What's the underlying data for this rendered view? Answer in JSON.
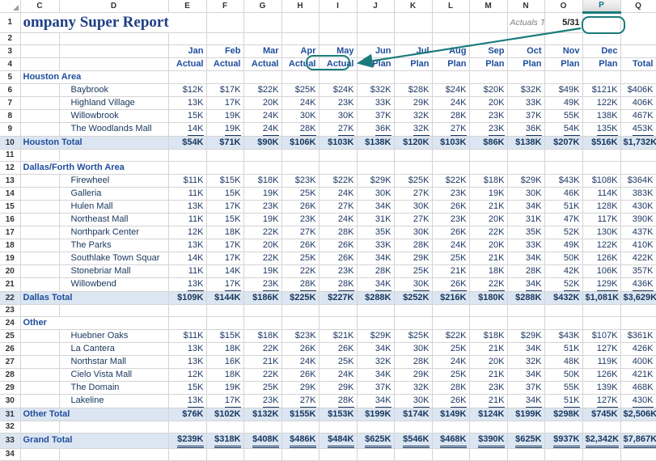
{
  "app": {
    "type": "spreadsheet",
    "accent_color": "#1a7b7b",
    "header_text_color": "#1f4e9c",
    "total_row_fill": "#dce6f2"
  },
  "column_headers": [
    "C",
    "D",
    "E",
    "F",
    "G",
    "H",
    "I",
    "J",
    "K",
    "L",
    "M",
    "N",
    "O",
    "P",
    "Q"
  ],
  "selected_column": "P",
  "row_headers": [
    "1",
    "2",
    "3",
    "4",
    "5",
    "6",
    "7",
    "8",
    "9",
    "10",
    "11",
    "12",
    "13",
    "14",
    "15",
    "16",
    "17",
    "18",
    "19",
    "20",
    "21",
    "22",
    "23",
    "24",
    "25",
    "26",
    "27",
    "28",
    "29",
    "30",
    "31",
    "32",
    "33",
    "34"
  ],
  "title": "ompany Super Report",
  "annotation": {
    "actuals_through_label": "Actuals Through:",
    "actuals_through_value": "5/31",
    "arrow_from": "P1 date box",
    "arrow_to": "May Actual header"
  },
  "headers": {
    "months": [
      "Jan",
      "Feb",
      "Mar",
      "Apr",
      "May",
      "Jun",
      "Jul",
      "Aug",
      "Sep",
      "Oct",
      "Nov",
      "Dec",
      ""
    ],
    "types": [
      "Actual",
      "Actual",
      "Actual",
      "Actual",
      "Actual",
      "Plan",
      "Plan",
      "Plan",
      "Plan",
      "Plan",
      "Plan",
      "Plan",
      "Total"
    ]
  },
  "sections": [
    {
      "row": 5,
      "name": "Houston Area",
      "rows": [
        {
          "row": 6,
          "label": "Baybrook",
          "values": [
            "$12K",
            "$17K",
            "$22K",
            "$25K",
            "$24K",
            "$32K",
            "$28K",
            "$24K",
            "$20K",
            "$32K",
            "$49K",
            "$121K",
            "$406K"
          ]
        },
        {
          "row": 7,
          "label": "Highland Village",
          "values": [
            "13K",
            "17K",
            "20K",
            "24K",
            "23K",
            "33K",
            "29K",
            "24K",
            "20K",
            "33K",
            "49K",
            "122K",
            "406K"
          ]
        },
        {
          "row": 8,
          "label": "Willowbrook",
          "values": [
            "15K",
            "19K",
            "24K",
            "30K",
            "30K",
            "37K",
            "32K",
            "28K",
            "23K",
            "37K",
            "55K",
            "138K",
            "467K"
          ]
        },
        {
          "row": 9,
          "label": "The Woodlands Mall",
          "underline": true,
          "values": [
            "14K",
            "19K",
            "24K",
            "28K",
            "27K",
            "36K",
            "32K",
            "27K",
            "23K",
            "36K",
            "54K",
            "135K",
            "453K"
          ]
        }
      ],
      "total": {
        "row": 10,
        "label": "Houston Total",
        "values": [
          "$54K",
          "$71K",
          "$90K",
          "$106K",
          "$103K",
          "$138K",
          "$120K",
          "$103K",
          "$86K",
          "$138K",
          "$207K",
          "$516K",
          "$1,732K"
        ]
      }
    },
    {
      "row": 12,
      "name": "Dallas/Forth Worth Area",
      "rows": [
        {
          "row": 13,
          "label": "Firewheel",
          "values": [
            "$11K",
            "$15K",
            "$18K",
            "$23K",
            "$22K",
            "$29K",
            "$25K",
            "$22K",
            "$18K",
            "$29K",
            "$43K",
            "$108K",
            "$364K"
          ]
        },
        {
          "row": 14,
          "label": "Galleria",
          "values": [
            "11K",
            "15K",
            "19K",
            "25K",
            "24K",
            "30K",
            "27K",
            "23K",
            "19K",
            "30K",
            "46K",
            "114K",
            "383K"
          ]
        },
        {
          "row": 15,
          "label": "Hulen Mall",
          "values": [
            "13K",
            "17K",
            "23K",
            "26K",
            "27K",
            "34K",
            "30K",
            "26K",
            "21K",
            "34K",
            "51K",
            "128K",
            "430K"
          ]
        },
        {
          "row": 16,
          "label": "Northeast Mall",
          "values": [
            "11K",
            "15K",
            "19K",
            "23K",
            "24K",
            "31K",
            "27K",
            "23K",
            "20K",
            "31K",
            "47K",
            "117K",
            "390K"
          ]
        },
        {
          "row": 17,
          "label": "Northpark Center",
          "values": [
            "12K",
            "18K",
            "22K",
            "27K",
            "28K",
            "35K",
            "30K",
            "26K",
            "22K",
            "35K",
            "52K",
            "130K",
            "437K"
          ]
        },
        {
          "row": 18,
          "label": "The Parks",
          "values": [
            "13K",
            "17K",
            "20K",
            "26K",
            "26K",
            "33K",
            "28K",
            "24K",
            "20K",
            "33K",
            "49K",
            "122K",
            "410K"
          ]
        },
        {
          "row": 19,
          "label": "Southlake Town Squar",
          "values": [
            "14K",
            "17K",
            "22K",
            "25K",
            "26K",
            "34K",
            "29K",
            "25K",
            "21K",
            "34K",
            "50K",
            "126K",
            "422K"
          ]
        },
        {
          "row": 20,
          "label": "Stonebriar Mall",
          "values": [
            "11K",
            "14K",
            "19K",
            "22K",
            "23K",
            "28K",
            "25K",
            "21K",
            "18K",
            "28K",
            "42K",
            "106K",
            "357K"
          ]
        },
        {
          "row": 21,
          "label": "Willowbend",
          "underline": true,
          "values": [
            "13K",
            "17K",
            "23K",
            "28K",
            "28K",
            "34K",
            "30K",
            "26K",
            "22K",
            "34K",
            "52K",
            "129K",
            "436K"
          ]
        }
      ],
      "total": {
        "row": 22,
        "label": "Dallas Total",
        "values": [
          "$109K",
          "$144K",
          "$186K",
          "$225K",
          "$227K",
          "$288K",
          "$252K",
          "$216K",
          "$180K",
          "$288K",
          "$432K",
          "$1,081K",
          "$3,629K"
        ]
      }
    },
    {
      "row": 24,
      "name": "Other",
      "rows": [
        {
          "row": 25,
          "label": "Huebner Oaks",
          "values": [
            "$11K",
            "$15K",
            "$18K",
            "$23K",
            "$21K",
            "$29K",
            "$25K",
            "$22K",
            "$18K",
            "$29K",
            "$43K",
            "$107K",
            "$361K"
          ]
        },
        {
          "row": 26,
          "label": "La Cantera",
          "values": [
            "13K",
            "18K",
            "22K",
            "26K",
            "26K",
            "34K",
            "30K",
            "25K",
            "21K",
            "34K",
            "51K",
            "127K",
            "426K"
          ]
        },
        {
          "row": 27,
          "label": "Northstar Mall",
          "values": [
            "13K",
            "16K",
            "21K",
            "24K",
            "25K",
            "32K",
            "28K",
            "24K",
            "20K",
            "32K",
            "48K",
            "119K",
            "400K"
          ]
        },
        {
          "row": 28,
          "label": "Cielo Vista Mall",
          "values": [
            "12K",
            "18K",
            "22K",
            "26K",
            "24K",
            "34K",
            "29K",
            "25K",
            "21K",
            "34K",
            "50K",
            "126K",
            "421K"
          ]
        },
        {
          "row": 29,
          "label": "The Domain",
          "values": [
            "15K",
            "19K",
            "25K",
            "29K",
            "29K",
            "37K",
            "32K",
            "28K",
            "23K",
            "37K",
            "55K",
            "139K",
            "468K"
          ]
        },
        {
          "row": 30,
          "label": "Lakeline",
          "underline": true,
          "values": [
            "13K",
            "17K",
            "23K",
            "27K",
            "28K",
            "34K",
            "30K",
            "26K",
            "21K",
            "34K",
            "51K",
            "127K",
            "430K"
          ]
        }
      ],
      "total": {
        "row": 31,
        "label": "Other Total",
        "values": [
          "$76K",
          "$102K",
          "$132K",
          "$155K",
          "$153K",
          "$199K",
          "$174K",
          "$149K",
          "$124K",
          "$199K",
          "$298K",
          "$745K",
          "$2,506K"
        ]
      }
    }
  ],
  "grand_total": {
    "row": 33,
    "label": "Grand Total",
    "values": [
      "$239K",
      "$318K",
      "$408K",
      "$486K",
      "$484K",
      "$625K",
      "$546K",
      "$468K",
      "$390K",
      "$625K",
      "$937K",
      "$2,342K",
      "$7,867K"
    ]
  }
}
